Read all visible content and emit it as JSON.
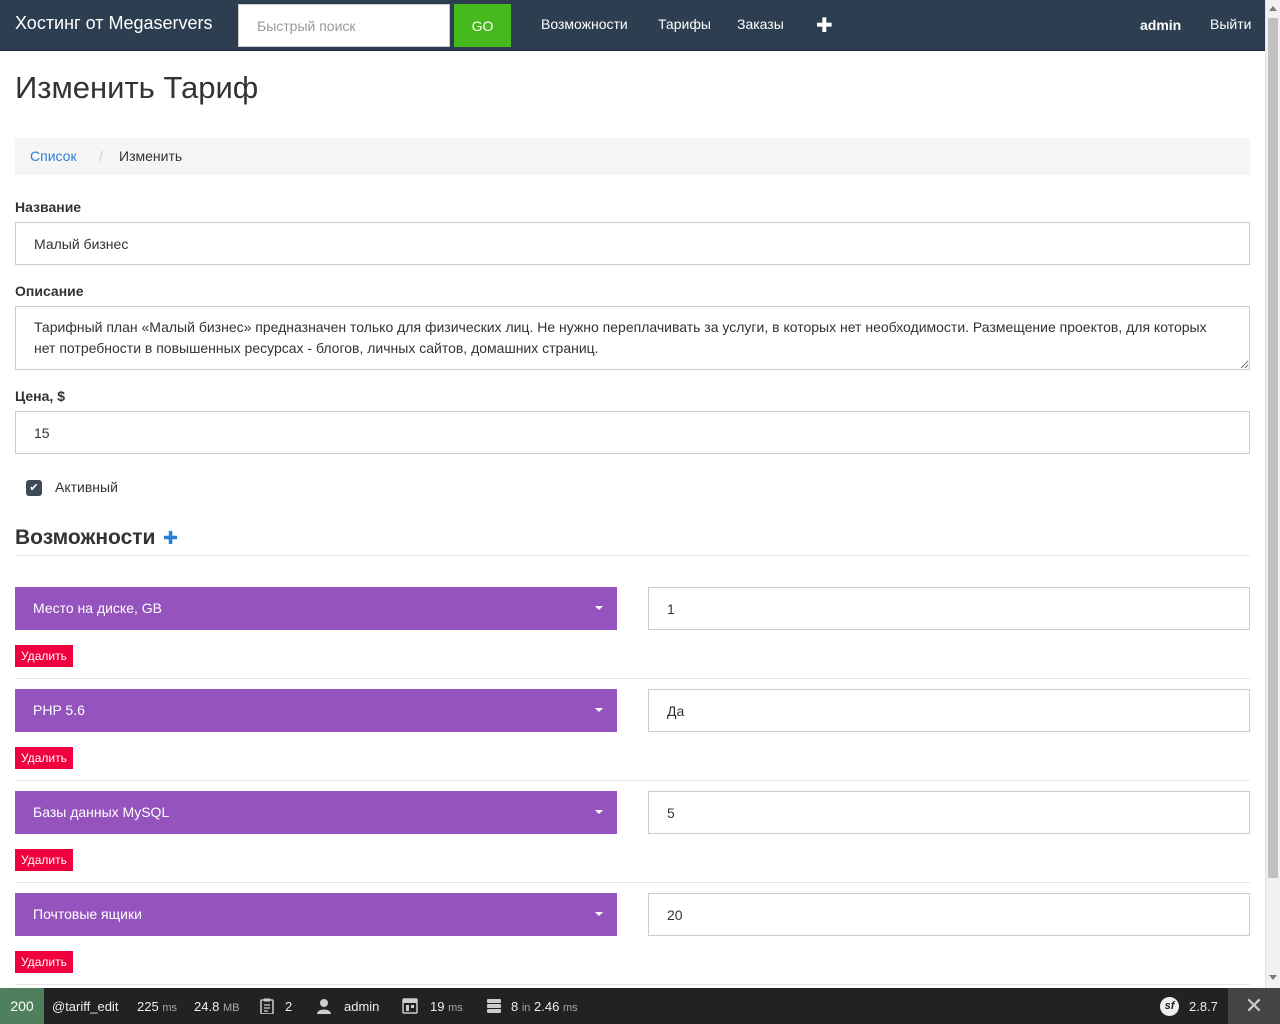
{
  "navbar": {
    "brand": "Хостинг от Megaservers",
    "search_placeholder": "Быстрый поиск",
    "go_label": "GO",
    "links": [
      "Возможности",
      "Тарифы",
      "Заказы"
    ],
    "add_icon": "plus-icon",
    "user": "admin",
    "logout": "Выйти"
  },
  "page": {
    "title": "Изменить Тариф",
    "breadcrumb": {
      "list": "Список",
      "separator": "/",
      "current": "Изменить"
    }
  },
  "form": {
    "name_label": "Название",
    "name_value": "Малый бизнес",
    "description_label": "Описание",
    "description_value": "Тарифный план «Малый бизнес» предназначен только для физических лиц. Не нужно переплачивать за услуги, в которых нет необходимости. Размещение проектов, для которых нет потребности в повышенных ресурсах - блогов, личных сайтов, домашних страниц.",
    "price_label": "Цена, $",
    "price_value": "15",
    "active_label": "Активный",
    "active_checked": true
  },
  "features": {
    "title": "Возможности",
    "delete_label": "Удалить",
    "items": [
      {
        "name": "Место на диске, GB",
        "value": "1"
      },
      {
        "name": "PHP 5.6",
        "value": "Да"
      },
      {
        "name": "Базы данных MySQL",
        "value": "5"
      },
      {
        "name": "Почтовые ящики",
        "value": "20"
      }
    ]
  },
  "colors": {
    "navbar": "#2c3e50",
    "go_button": "#46b91d",
    "feature_select": "#9554bd",
    "delete_button": "#f0003d",
    "link": "#2c7fd8"
  },
  "toolbar": {
    "status": "200",
    "route": "@tariff_edit",
    "time_value": "225",
    "time_unit": "ms",
    "memory_value": "24.8",
    "memory_unit": "MB",
    "logs_count": "2",
    "user": "admin",
    "render_value": "19",
    "render_unit": "ms",
    "db_queries": "8",
    "db_in": "in",
    "db_time": "2.46",
    "db_unit": "ms",
    "version": "2.8.7",
    "sf_logo": "sf",
    "close_icon": "✕"
  }
}
